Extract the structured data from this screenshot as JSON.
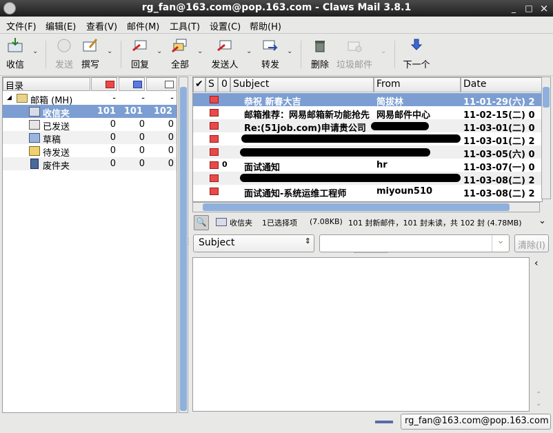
{
  "window": {
    "title": "rg_fan@163.com@pop.163.com - Claws Mail 3.8.1",
    "min": "_",
    "max": "□",
    "close": "×"
  },
  "menu": [
    "文件(F)",
    "编辑(E)",
    "查看(V)",
    "邮件(M)",
    "工具(T)",
    "设置(C)",
    "帮助(H)"
  ],
  "toolbar": {
    "receive": "收信",
    "send": "发送",
    "compose": "撰写",
    "reply": "回复",
    "reply_all": "全部",
    "reply_sender": "发送人",
    "forward": "转发",
    "delete": "删除",
    "spam": "垃圾邮件",
    "next": "下一个"
  },
  "folders": {
    "header": "目录",
    "root": {
      "name": "邮箱 (MH)",
      "new": "-",
      "unread": "-",
      "total": "-"
    },
    "items": [
      {
        "name": "收信夹",
        "new": "101",
        "unread": "101",
        "total": "102"
      },
      {
        "name": "已发送",
        "new": "0",
        "unread": "0",
        "total": "0"
      },
      {
        "name": "草稿",
        "new": "0",
        "unread": "0",
        "total": "0"
      },
      {
        "name": "待发送",
        "new": "0",
        "unread": "0",
        "total": "0"
      },
      {
        "name": "废件夹",
        "new": "0",
        "unread": "0",
        "total": "0"
      }
    ]
  },
  "msglist": {
    "columns": {
      "mark": "✔",
      "status": "S",
      "attach": "0",
      "subject": "Subject",
      "from": "From",
      "date": "Date"
    },
    "rows": [
      {
        "subject": "恭祝  新春大吉",
        "from": "简拔林",
        "date": "11-01-29(六) 2"
      },
      {
        "subject": "邮箱推荐：网易邮箱新功能抢先",
        "from": "网易邮件中心",
        "date": "11-02-15(二) 0"
      },
      {
        "subject": "Re:(51job.com)申请贵公司",
        "from": "",
        "date": "11-03-01(二) 0"
      },
      {
        "subject": "",
        "from": "",
        "date": "11-03-01(二) 2"
      },
      {
        "subject": "",
        "from": "",
        "date": "11-03-05(六) 0"
      },
      {
        "subject": "面试通知",
        "from": "hr",
        "date": "11-03-07(一) 0"
      },
      {
        "subject": "",
        "from": "",
        "date": "11-03-08(二) 2"
      },
      {
        "subject": "面试通知-系统运维工程师",
        "from": "miyoun510",
        "date": "11-03-08(二) 2"
      }
    ]
  },
  "status": {
    "folder": "收信夹",
    "selected": "1已选择项",
    "size": "(7.08KB)",
    "summary": "101 封新邮件，101 封未读，共 102 封 (4.78MB)"
  },
  "search": {
    "field": "Subject",
    "value": "",
    "clear": "清除(I)"
  },
  "account": "rg_fan@163.com@pop.163.com"
}
